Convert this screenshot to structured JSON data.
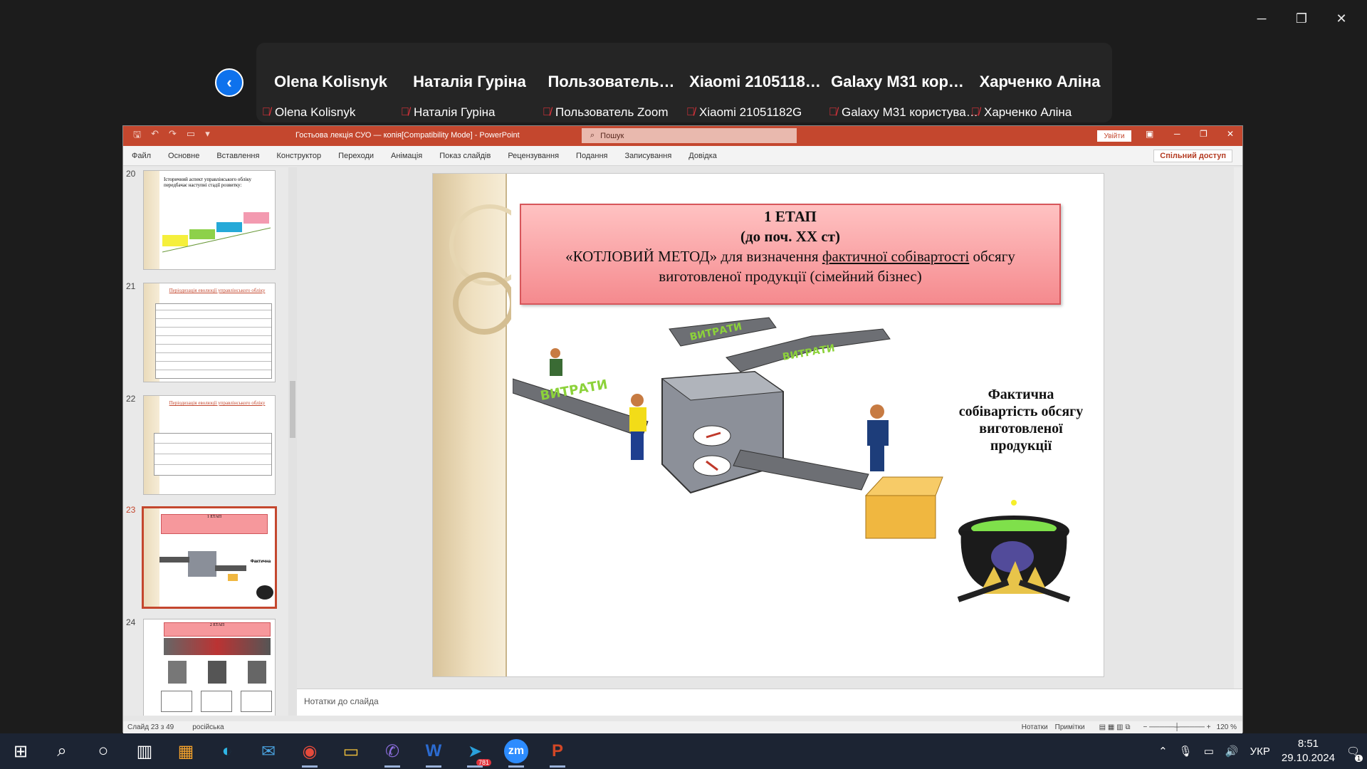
{
  "zoom": {
    "window_controls": [
      "─",
      "❐",
      "✕"
    ],
    "participants": [
      {
        "big": "Olena Kolisnyk",
        "small": "Olena Kolisnyk"
      },
      {
        "big": "Наталія Гуріна",
        "small": "Наталія Гуріна"
      },
      {
        "big": "Пользователь…",
        "small": "Пользователь Zoom"
      },
      {
        "big": "Xiaomi 2105118…",
        "small": "Xiaomi 21051182G"
      },
      {
        "big": "Galaxy M31 кор…",
        "small": "Galaxy M31 користува…"
      },
      {
        "big": "Харченко Аліна",
        "small": "Харченко Аліна"
      }
    ]
  },
  "ppt": {
    "doc_title": "Гостьова лекція СУО — копія[Compatibility Mode] - PowerPoint",
    "search_placeholder": "Пошук",
    "signin": "Увійти",
    "share": "Спільний доступ",
    "tabs": [
      "Файл",
      "Основне",
      "Вставлення",
      "Конструктор",
      "Переходи",
      "Анімація",
      "Показ слайдів",
      "Рецензування",
      "Подання",
      "Записування",
      "Довідка"
    ],
    "thumbnails": [
      {
        "num": "20",
        "text": "Історичний аспект управлінського обліку передбачає наступні стадії розвитку:"
      },
      {
        "num": "21",
        "text": "Періодизація еволюції управлінського обліку"
      },
      {
        "num": "22",
        "text": "Періодизація еволюції управлінського обліку"
      },
      {
        "num": "23",
        "text": "1 ЕТАП"
      },
      {
        "num": "24",
        "text": "2 ЕТАП"
      }
    ],
    "slide": {
      "title_line1": "1 ЕТАП",
      "title_line2": "(до поч. XX ст)",
      "title_line3a": "«КОТЛОВИЙ МЕТОД» для визначення ",
      "title_line3u": "фактичної собівартості",
      "title_line3b": " обсягу",
      "title_line4": "виготовленої продукції (сімейний бізнес)",
      "caption": "Фактична собівартість обсягу виготовленої продукції",
      "belt_label": "ВИТРАТИ"
    },
    "notes_placeholder": "Нотатки до слайда",
    "status": {
      "slide": "Слайд 23 з 49",
      "lang": "російська",
      "notes": "Нотатки",
      "comments": "Примітки",
      "zoom": "120 %"
    }
  },
  "taskbar": {
    "lang": "УКР",
    "time": "8:51",
    "date": "29.10.2024",
    "telegram_badge": "781",
    "notif_badge": "1"
  }
}
